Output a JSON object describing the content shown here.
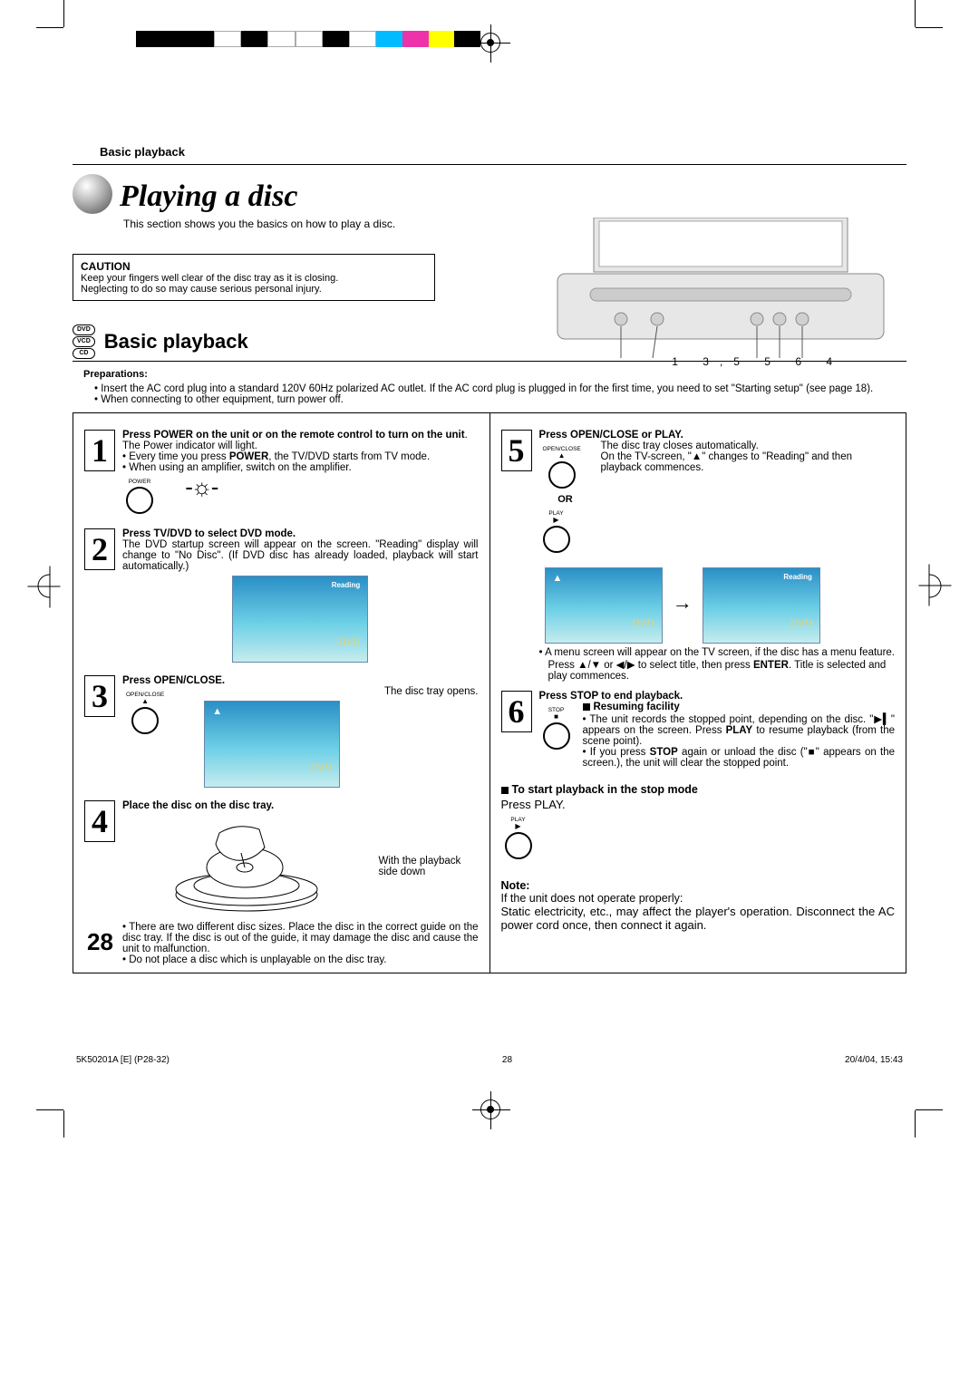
{
  "colorbar": [
    "#000000",
    "#000000",
    "#000000",
    "#ffffff",
    "#000000",
    "#ffffff",
    "#ffffff",
    "#000000",
    "#ffffff",
    "#00b1bf",
    "#ea2f8a",
    "#fff200",
    "#000000"
  ],
  "header": {
    "breadcrumb": "Basic playback"
  },
  "title": {
    "main": "Playing a disc",
    "subtitle": "This section shows you the basics on how to play a disc."
  },
  "caution": {
    "label": "CAUTION",
    "line1": "Keep your fingers well clear of the disc tray as it is closing.",
    "line2": "Neglecting to do so may cause serious personal injury."
  },
  "badges": [
    "DVD",
    "VCD",
    "CD"
  ],
  "section_title": "Basic playback",
  "callouts": "1  3,5     5  6  4",
  "preparations": {
    "label": "Preparations:",
    "items": [
      "Insert the AC cord plug into a standard 120V 60Hz polarized AC outlet. If the AC cord plug is plugged in for the first time, you need to set \"Starting setup\" (see page 18).",
      "When connecting to other equipment, turn power off."
    ]
  },
  "steps": {
    "s1": {
      "num": "1",
      "title_a": "Press POWER on the unit or on the remote control to turn on the unit",
      "period": ".",
      "line1": "The Power indicator will light.",
      "b1a": "Every time you press ",
      "b1b": "POWER",
      "b1c": ", the TV/DVD starts from TV mode.",
      "b2": "When using an amplifier, switch on the amplifier.",
      "btn": "POWER"
    },
    "s2": {
      "num": "2",
      "title": "Press TV/DVD to select DVD mode.",
      "body": "The DVD startup screen will appear on the screen. \"Reading\" display will change to \"No Disc\". (If DVD disc has already loaded, playback will start automatically.)",
      "reading": "Reading",
      "dvd": "DVD"
    },
    "s3": {
      "num": "3",
      "title": "Press OPEN/CLOSE.",
      "body": "The disc tray opens.",
      "btn": "OPEN/CLOSE",
      "eject": "▲",
      "dvd": "DVD"
    },
    "s4": {
      "num": "4",
      "title": "Place the disc on the disc tray.",
      "caption": "With the playback side down",
      "b1": "There are two different disc sizes. Place the disc in the correct guide on the disc tray. If the disc is out of the guide, it may damage the disc and cause the unit to malfunction.",
      "b2": "Do not place a disc which is unplayable on the disc tray."
    },
    "s5": {
      "num": "5",
      "title": "Press OPEN/CLOSE or PLAY.",
      "btn1": "OPEN/CLOSE",
      "sym1": "▲",
      "or": "OR",
      "btn2": "PLAY",
      "sym2": "▶",
      "l1": "The disc tray closes automatically.",
      "l2a": "On the TV-screen, \"",
      "l2sym": "▲",
      "l2b": "\" changes to \"Reading\" and then playback commences.",
      "eject": "▲",
      "reading": "Reading",
      "dvd": "DVD",
      "b1": "A menu screen will appear on the TV screen, if the disc has a menu feature.",
      "b2a": "Press ▲/▼ or ◀/▶ to select title, then press ",
      "b2b": "ENTER",
      "b2c": ". Title is selected and play commences."
    },
    "s6": {
      "num": "6",
      "title": "Press STOP to end playback.",
      "btn": "STOP",
      "sym": "■",
      "sub": "Resuming facility",
      "r1a": "The unit records the stopped point, depending on the disc. \"",
      "r1sym": "▶▍",
      "r1b": "\" appears on the screen. Press ",
      "r1c": "PLAY",
      "r1d": " to resume playback (from the scene point).",
      "r2a": "If you press ",
      "r2b": "STOP",
      "r2c": " again or unload the disc (\"",
      "r2sym": "■",
      "r2d": "\" appears on the screen.), the unit will clear the stopped point."
    }
  },
  "start_section": {
    "title": "To start playback in the stop mode",
    "press_a": "Press ",
    "press_b": "PLAY",
    "press_c": ".",
    "btn": "PLAY",
    "sym": "▶"
  },
  "note": {
    "label": "Note:",
    "sub": "If the unit does not operate properly:",
    "body": "Static electricity, etc., may affect the player's operation. Disconnect the AC power cord once, then connect it again."
  },
  "page_number": "28",
  "footer": {
    "left": "5K50201A [E] (P28-32)",
    "mid": "28",
    "right": "20/4/04, 15:43"
  }
}
